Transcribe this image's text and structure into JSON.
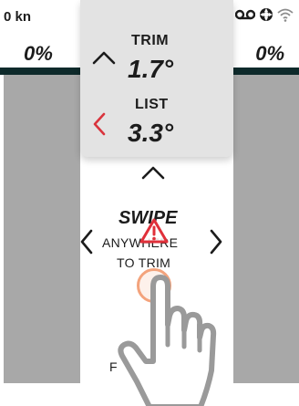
{
  "status": {
    "speed": "0 kn",
    "icons": [
      "voicemail-icon",
      "lifebuoy-icon",
      "wifi-icon"
    ]
  },
  "sides": {
    "left_percent": "0%",
    "right_percent": "0%"
  },
  "card": {
    "trim_label": "TRIM",
    "trim_value": "1.7°",
    "list_label": "LIST",
    "list_value": "3.3°"
  },
  "swipe": {
    "title": "SWIPE",
    "line1": "ANYWHERE",
    "line2": "TO TRIM",
    "bottom_fragment": "F"
  },
  "colors": {
    "dark_bar": "#0e2a2b",
    "side_column": "#a8a8a8",
    "card_bg": "#e3e3e3",
    "list_chevron": "#d9343d",
    "warning": "#e0303a",
    "touch_ring": "#f3a37c"
  }
}
